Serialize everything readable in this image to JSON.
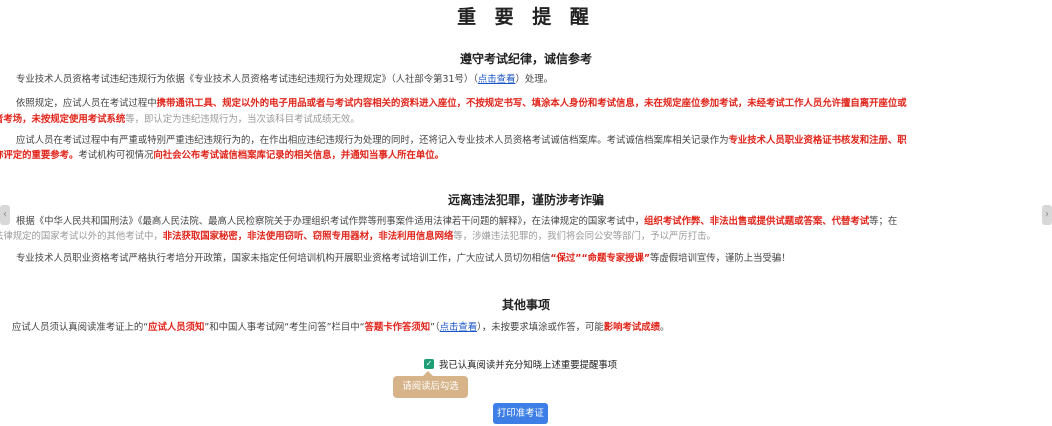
{
  "page_title": "重 要 提 醒",
  "section1": {
    "heading": "遵守考试纪律，诚信参考",
    "p1": {
      "a": "专业技术人员资格考试违纪违规行为依据《专业技术人员资格考试违纪违规行为处理规定》（人社部令第31号）（",
      "link": "点击查看",
      "b": "）处理。"
    },
    "p2": {
      "l1a": "依照规定，应试人员在考试过程中",
      "l1b": "携带通讯工具、规定以外的电子用品或者与考试内容相关的资料进入座位，不按规定书写、填涂本人身份和考试信息，未在规定座位参加考试，未经考试工作人员允许擅自离开座位或",
      "l2a": "者考场，未按规定使用考试系统",
      "l2b": "等，即认定为违纪违规行为，当次该科目考试成绩无效。"
    },
    "p3": {
      "l1a": "应试人员在考试过程中有严重或特别严重违纪违规行为的，在作出相应违纪违规行为处理的同时，还将记入专业技术人员资格考试诚信档案库。考试诚信档案库相关记录作为",
      "l1b": "专业技术人员职业资格证书核发和注册、职",
      "l2a": "称评定的重要参考。",
      "l2b": "考试机构可视情况",
      "l2c": "向社会公布考试诚信档案库记录的相关信息，并通知当事人所在单位。"
    }
  },
  "section2": {
    "heading": "远离违法犯罪，谨防涉考诈骗",
    "p1": {
      "l1a": "根据《中华人民共和国刑法》《最高人民法院、最高人民检察院关于办理组织考试作弊等刑事案件适用法律若干问题的解释》，在法律规定的国家考试中，",
      "l1b": "组织考试作弊、非法出售或提供试题或答案、代替考试",
      "l1c": "等；在",
      "l2a": "法律规定的国家考试以外的其他考试中，",
      "l2b": "非法获取国家秘密，非法使用窃听、窃照专用器材，非法利用信息网络",
      "l2c": "等，涉嫌违法犯罪的，我们将会同公安等部门，予以严厉打击。"
    },
    "p2": {
      "a": "专业技术人员职业资格考试严格执行考培分开政策，国家未指定任何培训机构开展职业资格考试培训工作，广大应试人员切勿相信",
      "b": "“保过”“命题专家授课”",
      "c": "等虚假培训宣传，谨防上当受骗！"
    }
  },
  "section3": {
    "heading": "其他事项",
    "p1": {
      "a": "应试人员须认真阅读准考证上的“",
      "b": "应试人员须知",
      "c": "”和中国人事考试网“考生问答”栏目中“",
      "d": "答题卡作答须知",
      "e": "”（",
      "link": "点击查看",
      "f": "），未按要求填涂或作答，可能",
      "g": "影响考试成绩",
      "h": "。"
    }
  },
  "confirm_checkbox": {
    "label": "我已认真阅读并充分知晓上述重要提醒事项",
    "checked": true
  },
  "tooltip": "请阅读后勾选",
  "print_button": "打印准考证",
  "colors": {
    "emphasis": "#e1261c",
    "link": "#1a55c9",
    "checkbox": "#1e9e74",
    "button": "#3d7fe6",
    "tooltip": "#d6b389"
  }
}
